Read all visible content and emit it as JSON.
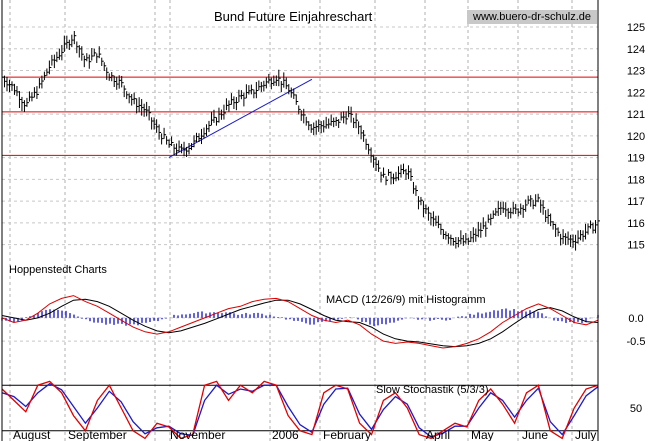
{
  "chart_data": [
    {
      "type": "ohlc",
      "title": "Bund Future Einjahreschart",
      "source": "www.buero-dr-schulz.de",
      "publisher": "Hoppenstedt Charts",
      "y_ticks": [
        115,
        116,
        117,
        118,
        119,
        120,
        121,
        122,
        123,
        124,
        125
      ],
      "ylim": [
        114.2,
        125.6
      ],
      "x_labels": [
        "August",
        "September",
        "November",
        "2006",
        "February",
        "April",
        "May",
        "June",
        "July"
      ],
      "horizontal_lines": [
        122.7,
        121.1,
        119.1
      ],
      "trendline": {
        "from": [
          0.28,
          119.0
        ],
        "to": [
          0.52,
          122.6
        ]
      },
      "x": [
        0.0,
        0.02,
        0.04,
        0.06,
        0.08,
        0.1,
        0.12,
        0.14,
        0.16,
        0.18,
        0.2,
        0.22,
        0.24,
        0.26,
        0.28,
        0.3,
        0.32,
        0.34,
        0.36,
        0.38,
        0.4,
        0.42,
        0.44,
        0.46,
        0.48,
        0.5,
        0.52,
        0.54,
        0.56,
        0.58,
        0.6,
        0.62,
        0.64,
        0.66,
        0.68,
        0.7,
        0.72,
        0.74,
        0.76,
        0.78,
        0.8,
        0.82,
        0.84,
        0.86,
        0.88,
        0.9,
        0.92,
        0.94,
        0.96,
        0.98,
        1.0
      ],
      "close": [
        122.7,
        122.2,
        121.4,
        122.1,
        123.2,
        123.9,
        124.6,
        123.4,
        123.8,
        122.8,
        122.4,
        121.6,
        121.2,
        120.3,
        119.6,
        119.3,
        119.6,
        120.3,
        120.8,
        121.4,
        121.8,
        122.0,
        122.4,
        122.7,
        122.2,
        121.2,
        120.4,
        120.5,
        120.6,
        121.0,
        120.4,
        119.2,
        118.1,
        118.2,
        118.4,
        117.0,
        116.2,
        115.6,
        115.2,
        115.1,
        115.6,
        116.1,
        116.8,
        116.5,
        116.9,
        117.0,
        116.0,
        115.3,
        115.2,
        115.6,
        116.0
      ],
      "macd": {
        "label": "MACD (12/26/9) mit Histogramm",
        "y_ticks": [
          0.0,
          -0.5
        ],
        "ylim": [
          -0.8,
          0.6
        ],
        "macd_line": [
          0.0,
          -0.1,
          -0.05,
          0.1,
          0.3,
          0.42,
          0.48,
          0.35,
          0.25,
          0.1,
          -0.05,
          -0.2,
          -0.3,
          -0.35,
          -0.3,
          -0.2,
          -0.1,
          0.0,
          0.1,
          0.2,
          0.25,
          0.35,
          0.4,
          0.42,
          0.35,
          0.2,
          0.05,
          -0.05,
          -0.1,
          -0.05,
          -0.15,
          -0.35,
          -0.5,
          -0.55,
          -0.52,
          -0.55,
          -0.6,
          -0.65,
          -0.62,
          -0.55,
          -0.45,
          -0.3,
          -0.1,
          0.05,
          0.2,
          0.3,
          0.2,
          0.05,
          -0.1,
          -0.15,
          -0.05
        ],
        "signal_line": [
          0.05,
          0.0,
          -0.05,
          0.0,
          0.1,
          0.25,
          0.38,
          0.4,
          0.35,
          0.25,
          0.1,
          -0.05,
          -0.18,
          -0.28,
          -0.32,
          -0.28,
          -0.2,
          -0.12,
          -0.02,
          0.08,
          0.18,
          0.25,
          0.32,
          0.38,
          0.38,
          0.3,
          0.18,
          0.05,
          -0.05,
          -0.08,
          -0.1,
          -0.2,
          -0.35,
          -0.45,
          -0.5,
          -0.52,
          -0.56,
          -0.6,
          -0.62,
          -0.6,
          -0.55,
          -0.45,
          -0.3,
          -0.12,
          0.05,
          0.18,
          0.22,
          0.15,
          0.02,
          -0.08,
          -0.1
        ],
        "histogram": [
          -0.05,
          -0.1,
          0.0,
          0.1,
          0.2,
          0.17,
          0.1,
          -0.05,
          -0.1,
          -0.15,
          -0.15,
          -0.15,
          -0.12,
          -0.07,
          0.02,
          0.08,
          0.1,
          0.12,
          0.12,
          0.12,
          0.07,
          0.1,
          0.08,
          0.04,
          -0.03,
          -0.1,
          -0.13,
          -0.1,
          -0.05,
          0.03,
          -0.05,
          -0.15,
          -0.15,
          -0.1,
          -0.02,
          -0.03,
          -0.04,
          -0.05,
          0.0,
          0.05,
          0.1,
          0.15,
          0.2,
          0.17,
          0.15,
          0.12,
          -0.02,
          -0.1,
          -0.12,
          -0.07,
          0.05
        ]
      },
      "stochastic": {
        "label": "Slow Stochastik (5/3/3)",
        "y_ticks": [
          50
        ],
        "ylim": [
          0,
          100
        ],
        "reference_lines": [
          80,
          20
        ],
        "k": [
          75,
          60,
          45,
          80,
          85,
          70,
          40,
          20,
          60,
          80,
          50,
          20,
          10,
          30,
          25,
          10,
          15,
          80,
          85,
          60,
          80,
          70,
          85,
          80,
          40,
          20,
          15,
          70,
          80,
          75,
          30,
          15,
          60,
          70,
          50,
          15,
          10,
          20,
          30,
          25,
          60,
          75,
          55,
          30,
          70,
          80,
          20,
          10,
          50,
          75,
          80
        ],
        "d": [
          70,
          65,
          52,
          70,
          82,
          74,
          52,
          30,
          50,
          72,
          58,
          32,
          16,
          24,
          26,
          16,
          14,
          60,
          80,
          68,
          75,
          72,
          80,
          80,
          52,
          28,
          18,
          55,
          75,
          76,
          42,
          22,
          48,
          65,
          55,
          24,
          12,
          17,
          26,
          26,
          50,
          70,
          60,
          38,
          60,
          76,
          32,
          15,
          40,
          66,
          78
        ]
      }
    }
  ]
}
